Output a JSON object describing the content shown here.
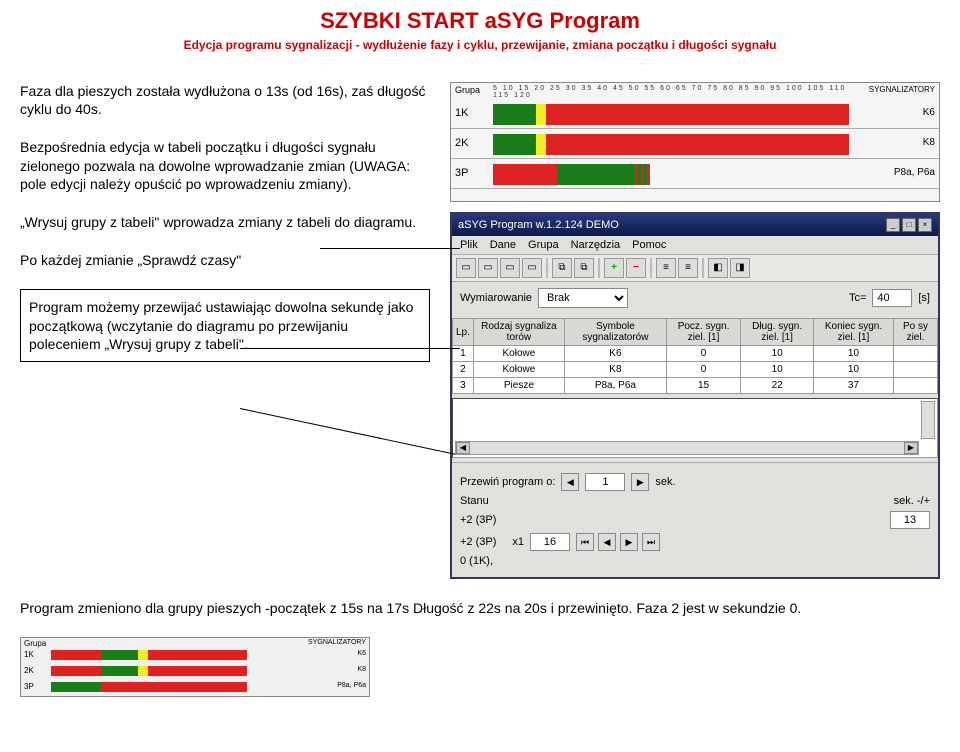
{
  "title": "SZYBKI START aSYG Program",
  "subtitle": "Edycja programu sygnalizacji - wydłużenie fazy i cyklu, przewijanie, zmiana początku i długości sygnału",
  "text_blocks": {
    "b1": "Faza dla pieszych została wydłużona o 13s (od 16s), zaś długość cyklu do 40s.",
    "b2": "Bezpośrednia edycja w tabeli początku i długości sygnału zielonego pozwala na dowolne wprowadzanie zmian (UWAGA: pole edycji należy opuścić po wprowadzeniu zmiany).",
    "b3": "„Wrysuj grupy z tabeli\" wprowadza zmiany z tabeli do diagramu.",
    "b4": "Po każdej zmianie „Sprawdź czasy\"",
    "b5": "Program możemy przewijać ustawiając dowolna sekundę jako początkową (wczytanie do diagramu po przewijaniu poleceniem „Wrysuj grupy z tabeli\"."
  },
  "bottom_text": "Program zmieniono dla grupy pieszych -początek z 15s na 17s Długość z 22s na 20s i przewinięto. Faza 2 jest w sekundzie 0.",
  "diagram_top": {
    "header_grupa": "Grupa",
    "header_sygn": "SYGNALIZATORY",
    "ticks": "5  10  15  20  25  30  35  40  45  50  55  60  65  70  75  80  85  90  95 100 105 110 115 120",
    "rows": [
      {
        "label": "1K",
        "sygn": "K6"
      },
      {
        "label": "2K",
        "sygn": "K8"
      },
      {
        "label": "3P",
        "sygn": "P8a, P6a"
      }
    ]
  },
  "app_window": {
    "title": "aSYG Program w.1.2.124 DEMO",
    "menu": [
      "Plik",
      "Dane",
      "Grupa",
      "Narzędzia",
      "Pomoc"
    ],
    "wymiarowanie_label": "Wymiarowanie",
    "wymiarowanie_value": "Brak",
    "tc_label": "Tc=",
    "tc_value": "40",
    "tc_unit": "[s]",
    "table": {
      "headers": [
        "Lp.",
        "Rodzaj sygnaliza torów",
        "Symbole sygnalizatorów",
        "Pocz. sygn. ziel. [1]",
        "Dług. sygn. ziel. [1]",
        "Koniec sygn. ziel. [1]",
        "Po sy ziel."
      ],
      "rows": [
        [
          "1",
          "Kołowe",
          "K6",
          "0",
          "10",
          "10",
          ""
        ],
        [
          "2",
          "Kołowe",
          "K8",
          "0",
          "10",
          "10",
          ""
        ],
        [
          "3",
          "Piesze",
          "P8a, P6a",
          "15",
          "22",
          "37",
          ""
        ]
      ]
    },
    "przewin_label": "Przewiń program o:",
    "przewin_value": "1",
    "przewin_unit": "sek.",
    "stanu_label": "Stanu",
    "sek_label": "sek. -/+",
    "sek_value": "13",
    "plus2_3p_a": "+2 (3P)",
    "plus2_3p_b": "+2 (3P)",
    "zero_1k": "0 (1K),",
    "x1_label": "x1",
    "x1_value": "16"
  },
  "diagram_bottom": {
    "header_grupa": "Grupa",
    "header_sygn": "SYGNALIZATORY",
    "rows": [
      {
        "label": "1K",
        "sygn": "K6"
      },
      {
        "label": "2K",
        "sygn": "K8"
      },
      {
        "label": "3P",
        "sygn": "P8a, P6a"
      }
    ]
  }
}
